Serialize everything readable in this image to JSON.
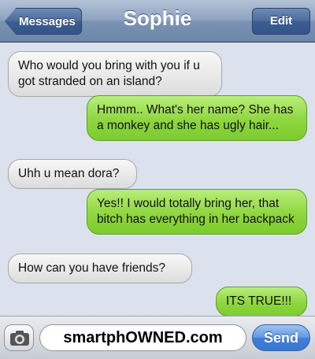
{
  "header": {
    "back_label": "Messages",
    "title": "Sophie",
    "edit_label": "Edit"
  },
  "messages": [
    {
      "direction": "incoming",
      "text": "Who would you bring with you if u got stranded on an island?"
    },
    {
      "direction": "outgoing",
      "text": "Hmmm.. What's her name? She has a monkey and she has ugly hair..."
    },
    {
      "direction": "incoming",
      "text": "Uhh u mean dora?"
    },
    {
      "direction": "outgoing",
      "text": "Yes!! I would totally bring her, that bitch has everything in her backpack"
    },
    {
      "direction": "incoming",
      "text": "How can you have friends?"
    },
    {
      "direction": "outgoing",
      "text": "ITS TRUE!!!"
    }
  ],
  "compose": {
    "text": "smartphOWNED.com",
    "send_label": "Send",
    "camera_icon": "camera-icon"
  },
  "colors": {
    "incoming_bubble": "#e6e6e6",
    "outgoing_bubble": "#8fd63f",
    "navbar": "#8ea3bf",
    "send_button": "#3f7fd8"
  }
}
